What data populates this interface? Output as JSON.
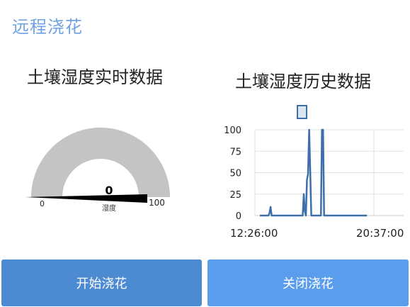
{
  "app": {
    "title": "远程浇花"
  },
  "realtime_panel": {
    "title": "土壤湿度实时数据",
    "gauge": {
      "value": 0,
      "value_text": "0",
      "unit_label": "湿度",
      "min": 0,
      "max": 100,
      "min_text": "0",
      "max_text": "100",
      "track_color": "#c4c4c4",
      "needle_color": "#000000"
    }
  },
  "history_panel": {
    "title": "土壤湿度历史数据"
  },
  "chart_data": {
    "type": "line",
    "title": "",
    "xlabel": "",
    "ylabel": "",
    "ylim": [
      0,
      100
    ],
    "yticks": [
      0,
      25,
      50,
      75,
      100
    ],
    "xtick_labels": [
      "12:26:00",
      "20:37:00"
    ],
    "legend": "top-center",
    "grid": true,
    "series": [
      {
        "color": "#3f6fa8",
        "x": [
          0.0,
          0.08,
          0.09,
          0.1,
          0.11,
          0.12,
          0.13,
          0.4,
          0.41,
          0.42,
          0.43,
          0.44,
          0.45,
          0.46,
          0.47,
          0.48,
          0.49,
          0.5,
          0.51,
          0.52,
          0.53,
          0.54,
          0.55,
          0.56,
          0.57,
          0.58,
          0.59,
          0.6,
          1.0
        ],
        "y": [
          0,
          0,
          3,
          10,
          0,
          0,
          0,
          0,
          25,
          5,
          0,
          42,
          48,
          100,
          52,
          0,
          0,
          0,
          0,
          0,
          0,
          0,
          0,
          0,
          0,
          100,
          100,
          0,
          0
        ]
      }
    ]
  },
  "buttons": {
    "start_label": "开始浇花",
    "stop_label": "关闭浇花",
    "start_color": "#4c8ad2",
    "stop_color": "#5b9ded"
  }
}
